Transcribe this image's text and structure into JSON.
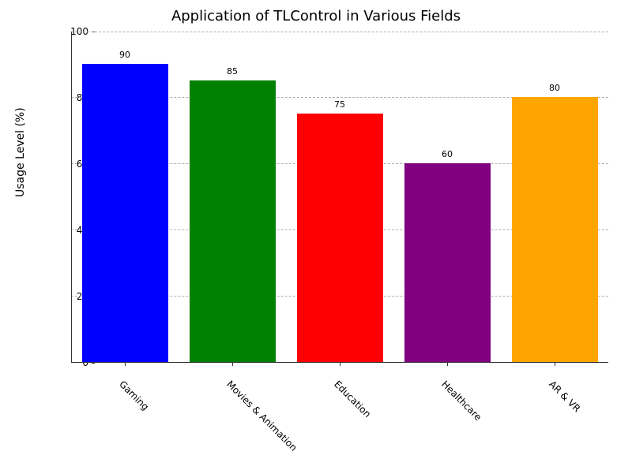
{
  "chart_data": {
    "type": "bar",
    "title": "Application of TLControl in Various Fields",
    "xlabel": "",
    "ylabel": "Usage Level (%)",
    "ylim": [
      0,
      100
    ],
    "yticks": [
      0,
      20,
      40,
      60,
      80,
      100
    ],
    "categories": [
      "Gaming",
      "Movies & Animation",
      "Education",
      "Healthcare",
      "AR & VR"
    ],
    "values": [
      90,
      85,
      75,
      60,
      80
    ],
    "colors": [
      "#0000ff",
      "#008000",
      "#ff0000",
      "#800080",
      "#ffa500"
    ],
    "grid": {
      "axis": "y",
      "style": "dashed"
    }
  }
}
